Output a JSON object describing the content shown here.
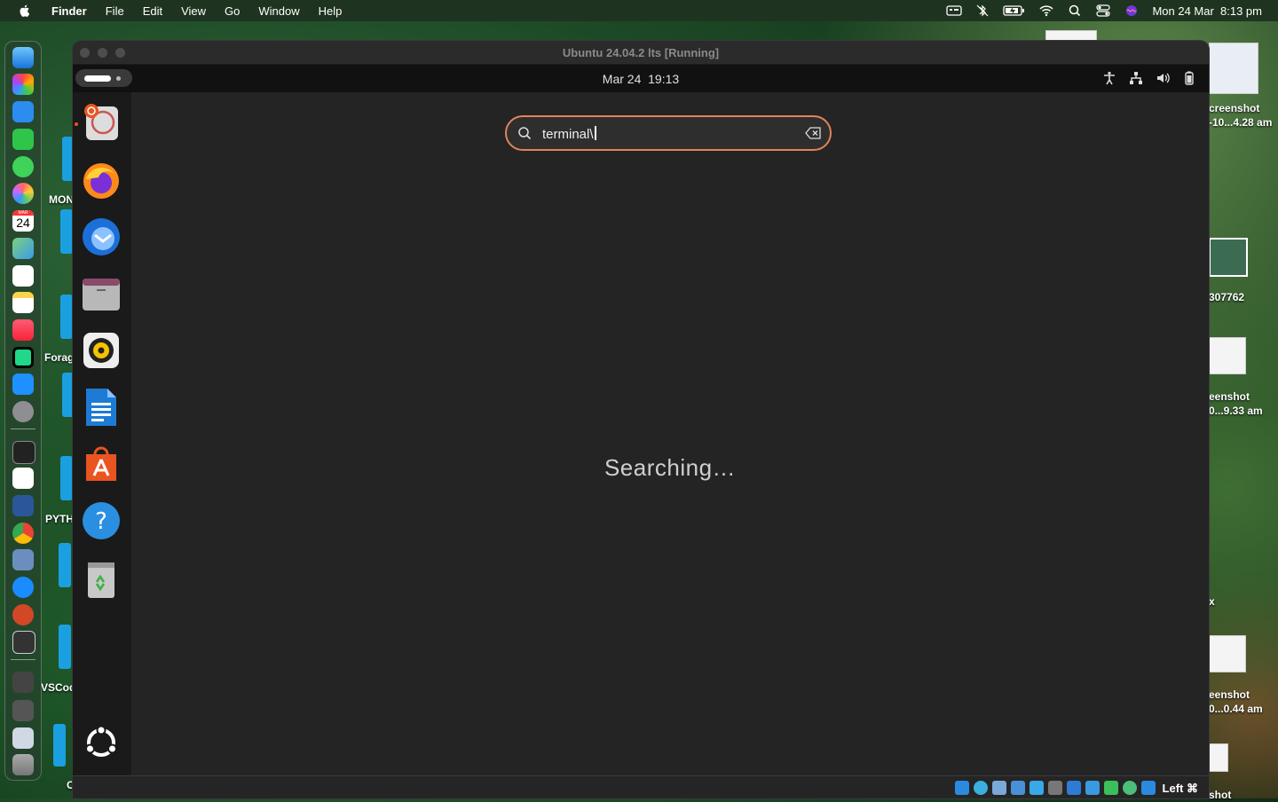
{
  "menubar": {
    "app_name": "Finder",
    "menus": [
      "File",
      "Edit",
      "View",
      "Go",
      "Window",
      "Help"
    ],
    "datetime": "Mon 24 Mar  8:13 pm"
  },
  "desktop": {
    "left_labels": [
      "MON",
      "Forag",
      "PYTH",
      "VSCod",
      "C"
    ],
    "right_labels": [
      "creenshot",
      "-10...4.28 am",
      "307762",
      "eenshot",
      "0...9.33 am",
      "x",
      "eenshot",
      "0...0.44 am",
      "shot"
    ]
  },
  "dock": {
    "calendar_day": "24",
    "calendar_month": "MAR"
  },
  "vm": {
    "title": "Ubuntu 24.04.2 lts [Running]",
    "clock": "Mar 24  19:13",
    "search_value": "terminal\\",
    "status_text": "Searching…",
    "host_key": "Left ⌘"
  }
}
